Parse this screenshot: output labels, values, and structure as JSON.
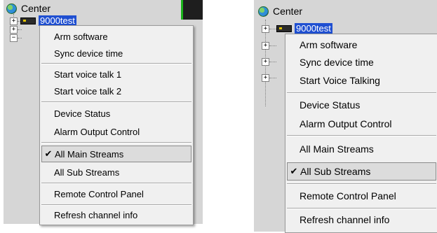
{
  "left": {
    "root_label": "Center",
    "device_label": "9000test",
    "menu": {
      "items": [
        {
          "label": "Arm software"
        },
        {
          "label": "Sync device time"
        },
        {
          "label": "Start voice talk 1"
        },
        {
          "label": "Start voice talk 2"
        },
        {
          "label": "Device Status"
        },
        {
          "label": "Alarm Output Control"
        },
        {
          "label": "All Main Streams",
          "checked": true
        },
        {
          "label": "All Sub Streams"
        },
        {
          "label": "Remote Control Panel"
        },
        {
          "label": "Refresh channel info"
        }
      ]
    }
  },
  "right": {
    "root_label": "Center",
    "device_label": "9000test",
    "menu": {
      "items": [
        {
          "label": "Arm software"
        },
        {
          "label": "Sync device time"
        },
        {
          "label": "Start Voice Talking"
        },
        {
          "label": "Device Status"
        },
        {
          "label": "Alarm Output Control"
        },
        {
          "label": "All Main Streams"
        },
        {
          "label": "All Sub Streams",
          "checked": true
        },
        {
          "label": "Remote Control Panel"
        },
        {
          "label": "Refresh channel info"
        }
      ]
    }
  },
  "icons": {
    "tree_root": "globe-icon",
    "device": "dvr-device-icon",
    "expander_collapsed": "+",
    "expander_expanded": "−",
    "check": "✔"
  },
  "colors": {
    "panel_bg": "#d6d6d6",
    "menu_bg": "#f0f0f0",
    "selection_bg": "#1f4fd1",
    "accent_green": "#1bb31b"
  }
}
